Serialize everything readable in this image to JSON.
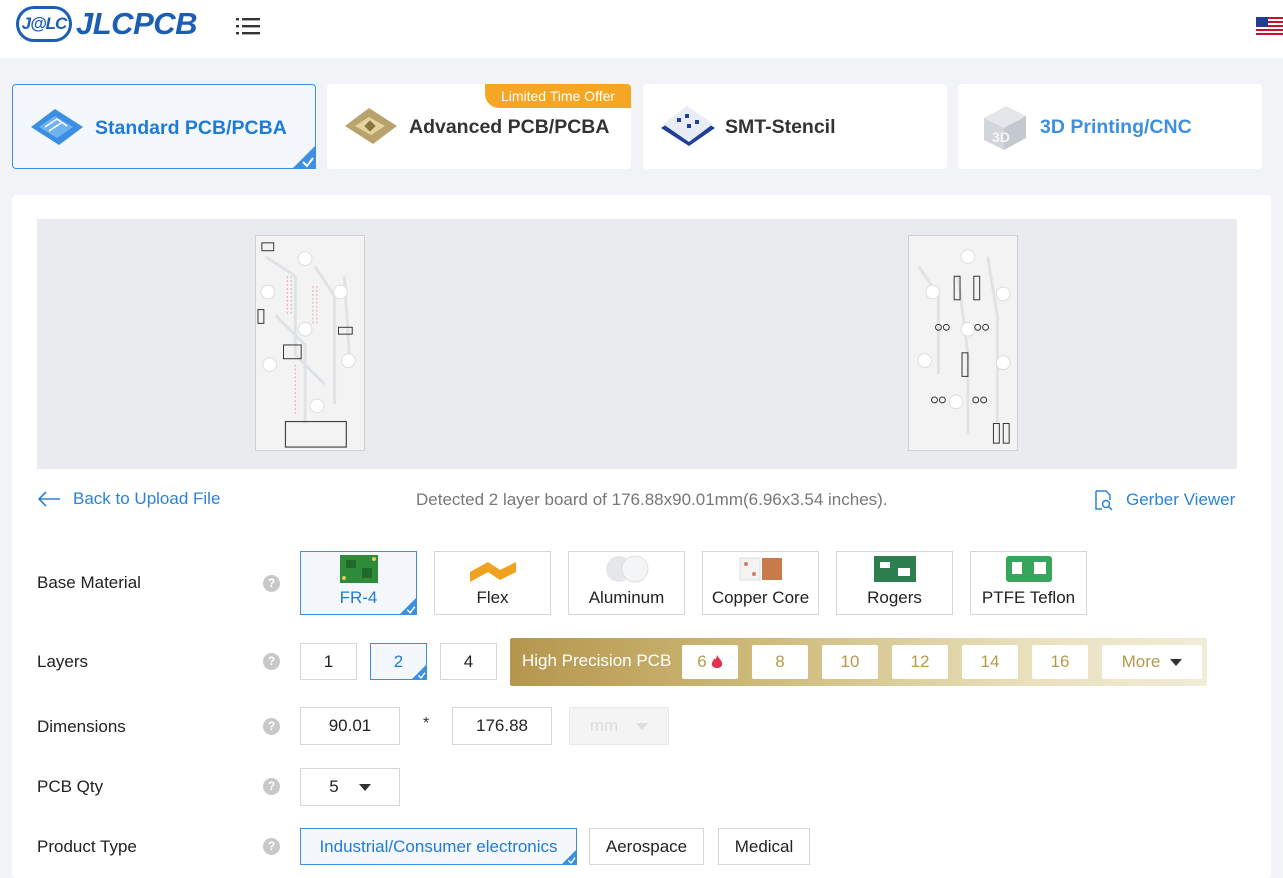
{
  "header": {
    "logo_badge": "J@LC",
    "logo_text": "JLCPCB"
  },
  "tabs": [
    {
      "label": "Standard PCB/PCBA",
      "active": true
    },
    {
      "label": "Advanced PCB/PCBA",
      "badge": "Limited Time Offer"
    },
    {
      "label": "SMT-Stencil"
    },
    {
      "label": "3D Printing/CNC"
    }
  ],
  "file_bar": {
    "back_label": "Back to Upload File",
    "detected_text": "Detected 2 layer board of 176.88x90.01mm(6.96x3.54 inches).",
    "gerber_label": "Gerber Viewer"
  },
  "form": {
    "base_material": {
      "label": "Base Material",
      "options": [
        "FR-4",
        "Flex",
        "Aluminum",
        "Copper Core",
        "Rogers",
        "PTFE Teflon"
      ],
      "selected": "FR-4"
    },
    "layers": {
      "label": "Layers",
      "options": [
        "1",
        "2",
        "4"
      ],
      "selected": "2",
      "high_precision_label": "High Precision PCB",
      "high_precision_options": [
        "6",
        "8",
        "10",
        "12",
        "14",
        "16"
      ],
      "more_label": "More"
    },
    "dimensions": {
      "label": "Dimensions",
      "width": "90.01",
      "separator": "*",
      "height": "176.88",
      "unit": "mm"
    },
    "pcb_qty": {
      "label": "PCB Qty",
      "value": "5"
    },
    "product_type": {
      "label": "Product Type",
      "options": [
        "Industrial/Consumer electronics",
        "Aerospace",
        "Medical"
      ],
      "selected": "Industrial/Consumer electronics"
    },
    "help_glyph": "?"
  },
  "colors": {
    "brand_blue": "#1b5fb5",
    "link_blue": "#2b82d9",
    "selected_border": "#3d8fe0",
    "offer_orange": "#f5a623",
    "gold": "#b5964d"
  }
}
